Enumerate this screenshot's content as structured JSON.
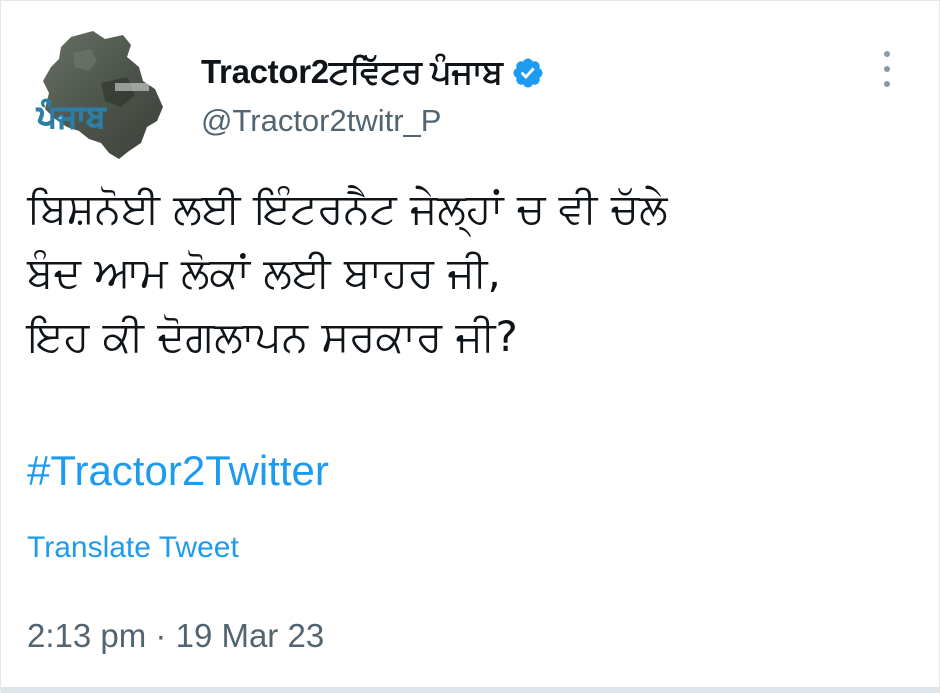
{
  "tweet": {
    "author": {
      "display_name": "Tractor2ਟਵਿੱਟਰ ਪੰਜਾਬ",
      "handle": "@Tractor2twitr_P",
      "verified": true,
      "avatar_text": "ਪੰਜਾਬ"
    },
    "text_lines": [
      "ਬਿਸ਼ਨੋਈ ਲਈ ਇੰਟਰਨੈਟ ਜੇਲ੍ਹਾਂ ਚ ਵੀ ਚੱਲੇ",
      "ਬੰਦ ਆਮ ਲੋਕਾਂ ਲਈ ਬਾਹਰ ਜੀ,",
      "ਇਹ ਕੀ ਦੋਗਲਾਪਨ ਸਰਕਾਰ ਜੀ?"
    ],
    "hashtag": "#Tractor2Twitter",
    "translate_label": "Translate Tweet",
    "time": "2:13 pm",
    "separator": "·",
    "date": "19 Mar 23"
  },
  "colors": {
    "link_blue": "#1d9bf0",
    "secondary_text": "#536471",
    "primary_text": "#0f1419"
  },
  "icons": {
    "verified": "verified-badge-icon",
    "more": "more-options-icon"
  }
}
